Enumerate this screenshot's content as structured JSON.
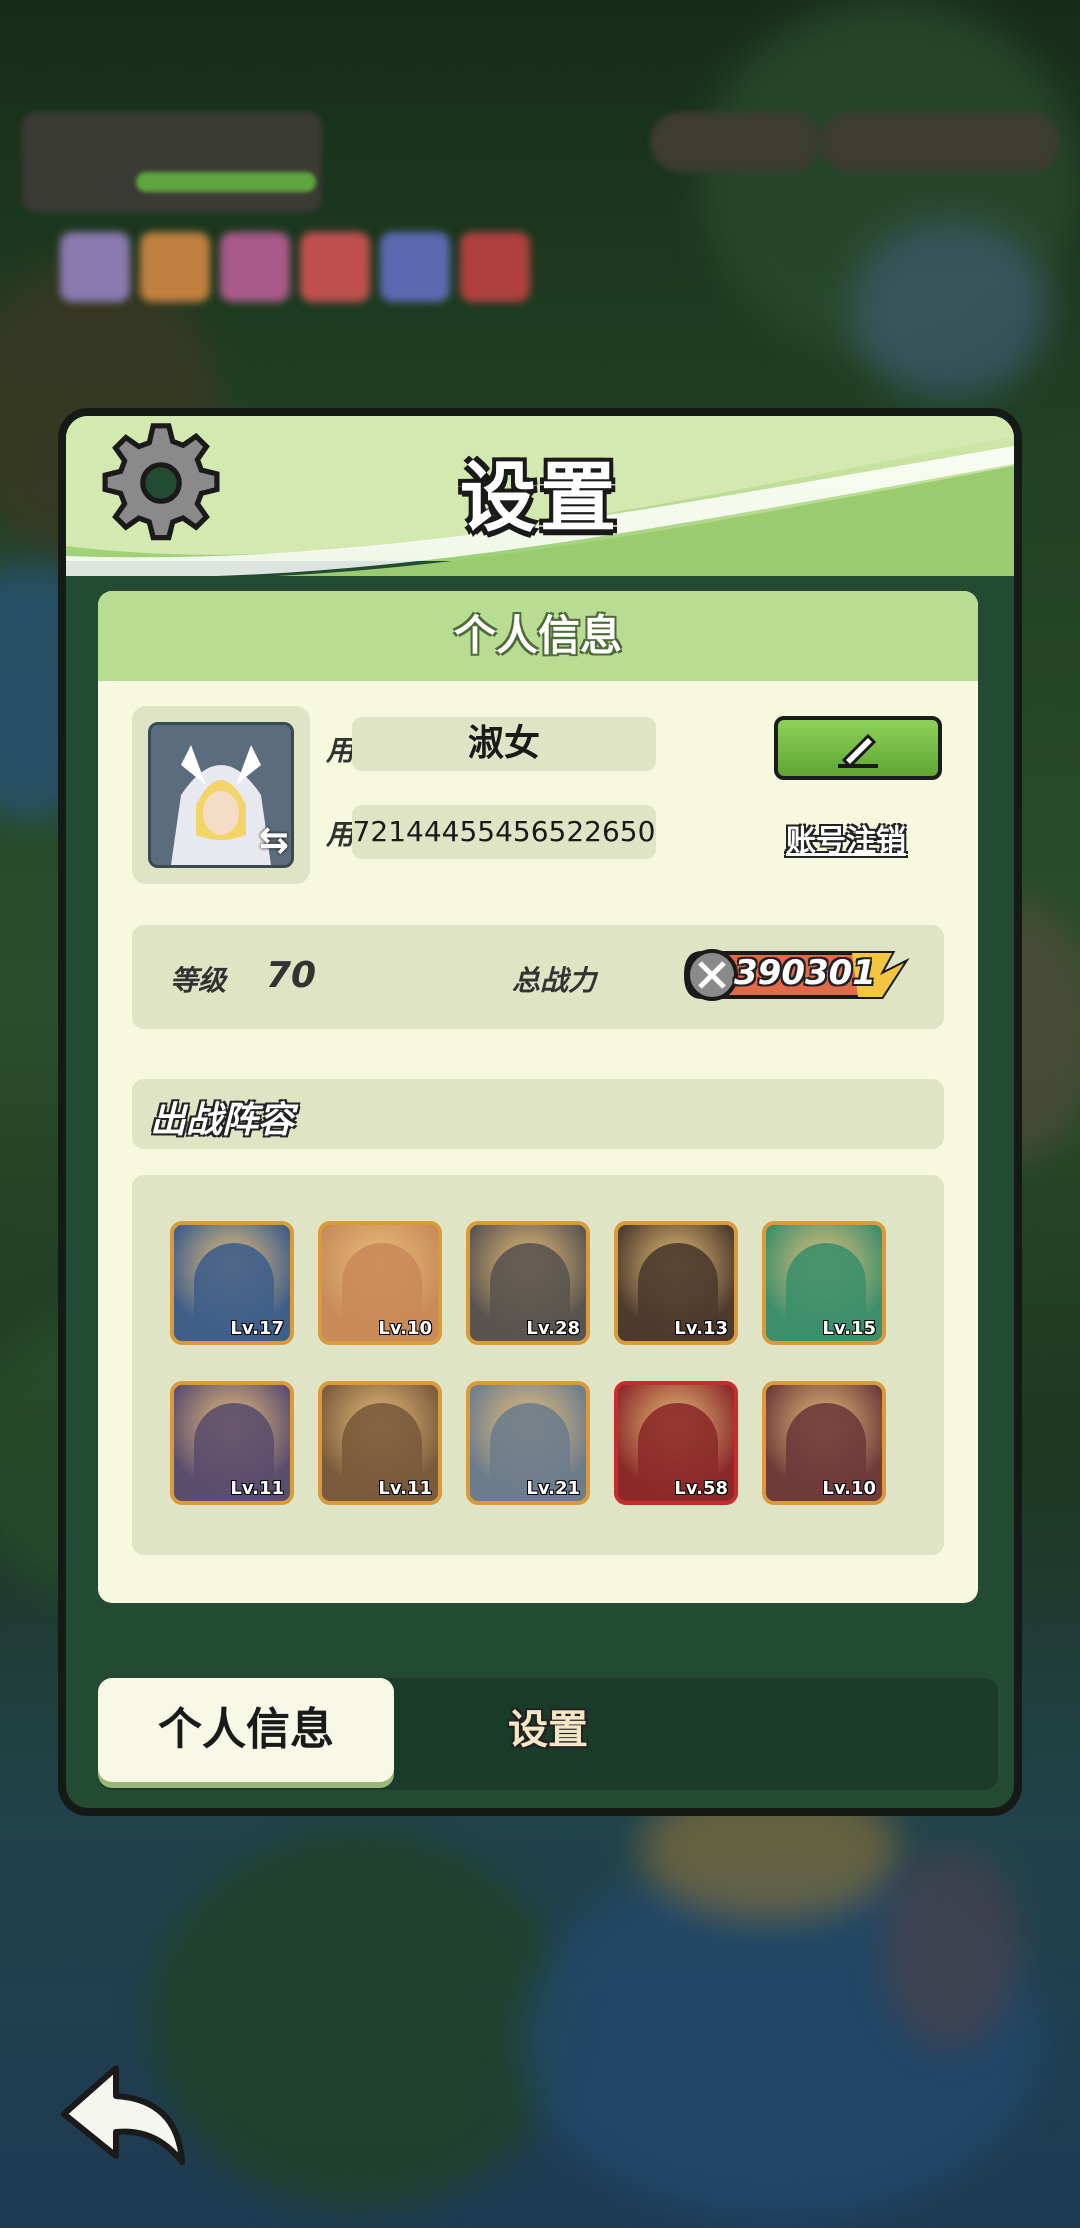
{
  "panel": {
    "title": "设置",
    "section_title": "个人信息",
    "profile": {
      "nickname_label": "用户昵称",
      "nickname": "淑女",
      "id_label": "用户 ID",
      "user_id": "7214445545652​2650",
      "cancel_account_label": "账号注销"
    },
    "stats": {
      "level_label": "等级",
      "level": "70",
      "power_label": "总战力",
      "power": "390301"
    },
    "team": {
      "title": "出战阵容",
      "heroes": [
        {
          "level": "Lv.17",
          "frame": "gold",
          "color": "#3f5e8a"
        },
        {
          "level": "Lv.10",
          "frame": "gold",
          "color": "#c98a5a"
        },
        {
          "level": "Lv.28",
          "frame": "gold",
          "color": "#5a5450"
        },
        {
          "level": "Lv.13",
          "frame": "gold",
          "color": "#4d3a2c"
        },
        {
          "level": "Lv.15",
          "frame": "gold",
          "color": "#3c8f6c"
        },
        {
          "level": "Lv.11",
          "frame": "gold",
          "color": "#5b4d6e"
        },
        {
          "level": "Lv.11",
          "frame": "gold",
          "color": "#7a5a3c"
        },
        {
          "level": "Lv.21",
          "frame": "gold",
          "color": "#6d7c8c"
        },
        {
          "level": "Lv.58",
          "frame": "red",
          "color": "#8c2a2a"
        },
        {
          "level": "Lv.10",
          "frame": "gold",
          "color": "#6e3a3a"
        }
      ]
    },
    "tabs": {
      "active": "个人信息",
      "other": "设置"
    }
  },
  "icons": [
    "gear-icon",
    "edit-pencil-icon",
    "swap-icon",
    "sword-icon",
    "back-arrow-icon"
  ]
}
